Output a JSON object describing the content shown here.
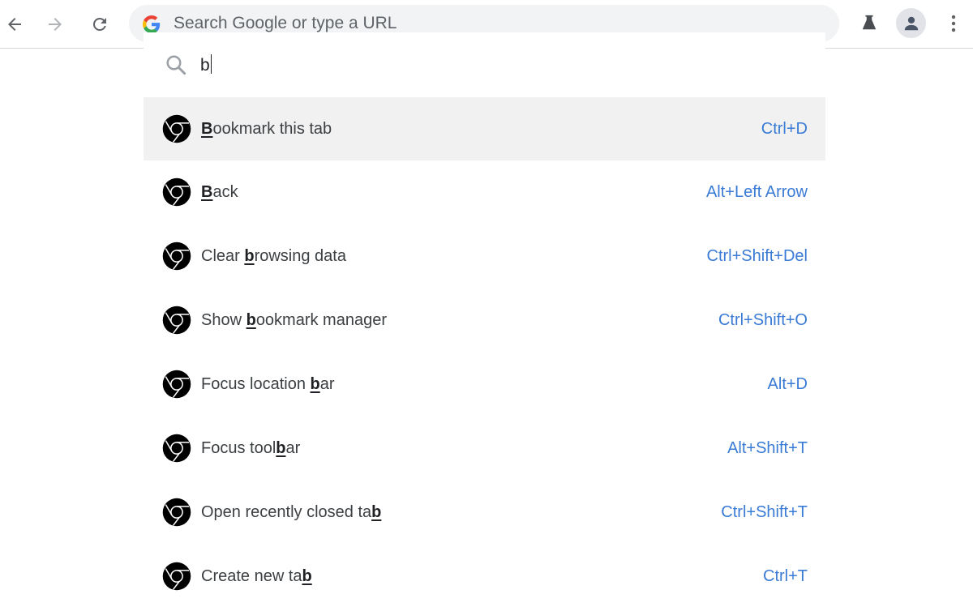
{
  "toolbar": {
    "back_label": "Back",
    "forward_label": "Forward",
    "reload_label": "Reload",
    "omnibox_placeholder": "Search Google or type a URL",
    "labs_icon": "flask-icon",
    "profile_icon": "person-icon",
    "menu_icon": "more-vert-icon"
  },
  "dropdown": {
    "query": "b",
    "search_icon": "search-icon",
    "suggestions": [
      {
        "pre": "",
        "match": "B",
        "post": "ookmark this tab",
        "shortcut": "Ctrl+D",
        "selected": true
      },
      {
        "pre": "",
        "match": "B",
        "post": "ack",
        "shortcut": "Alt+Left Arrow",
        "selected": false
      },
      {
        "pre": "Clear ",
        "match": "b",
        "post": "rowsing data",
        "shortcut": "Ctrl+Shift+Del",
        "selected": false
      },
      {
        "pre": "Show ",
        "match": "b",
        "post": "ookmark manager",
        "shortcut": "Ctrl+Shift+O",
        "selected": false
      },
      {
        "pre": "Focus location ",
        "match": "b",
        "post": "ar",
        "shortcut": "Alt+D",
        "selected": false
      },
      {
        "pre": "Focus tool",
        "match": "b",
        "post": "ar",
        "shortcut": "Alt+Shift+T",
        "selected": false
      },
      {
        "pre": "Open recently closed ta",
        "match": "b",
        "post": "",
        "shortcut": "Ctrl+Shift+T",
        "selected": false
      },
      {
        "pre": "Create new ta",
        "match": "b",
        "post": "",
        "shortcut": "Ctrl+T",
        "selected": false
      }
    ]
  },
  "colors": {
    "shortcut": "#3a7bd5",
    "selected_row": "#f1f1f1",
    "omnibox_bg": "#f1f3f4"
  }
}
